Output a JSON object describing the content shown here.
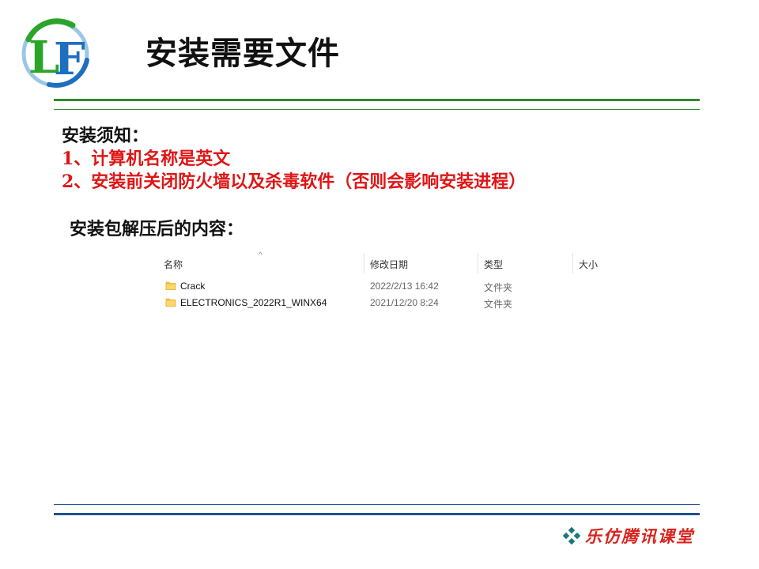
{
  "slide": {
    "title": "安装需要文件",
    "logo_text": "LF"
  },
  "notice": {
    "heading": "安装须知：",
    "items": [
      "1、计算机名称是英文",
      "2、安装前关闭防火墙以及杀毒软件（否则会影响安装进程）"
    ]
  },
  "package": {
    "label": "安装包解压后的内容："
  },
  "explorer": {
    "columns": {
      "name": "名称",
      "modified": "修改日期",
      "type": "类型",
      "size": "大小"
    },
    "sort_indicator": "^",
    "rows": [
      {
        "name": "Crack",
        "modified": "2022/2/13 16:42",
        "type": "文件夹",
        "size": "",
        "icon": "folder-icon"
      },
      {
        "name": "ELECTRONICS_2022R1_WINX64",
        "modified": "2021/12/20 8:24",
        "type": "文件夹",
        "size": "",
        "icon": "folder-icon"
      }
    ]
  },
  "footer": {
    "brand": "乐仿腾讯课堂",
    "icon": "diamond-cluster-icon"
  },
  "colors": {
    "accent_green": "#2e8b2e",
    "accent_blue": "#1f4f8f",
    "warning_red": "#e01515",
    "brand_red": "#d8241e",
    "folder_yellow": "#f5c84c"
  }
}
